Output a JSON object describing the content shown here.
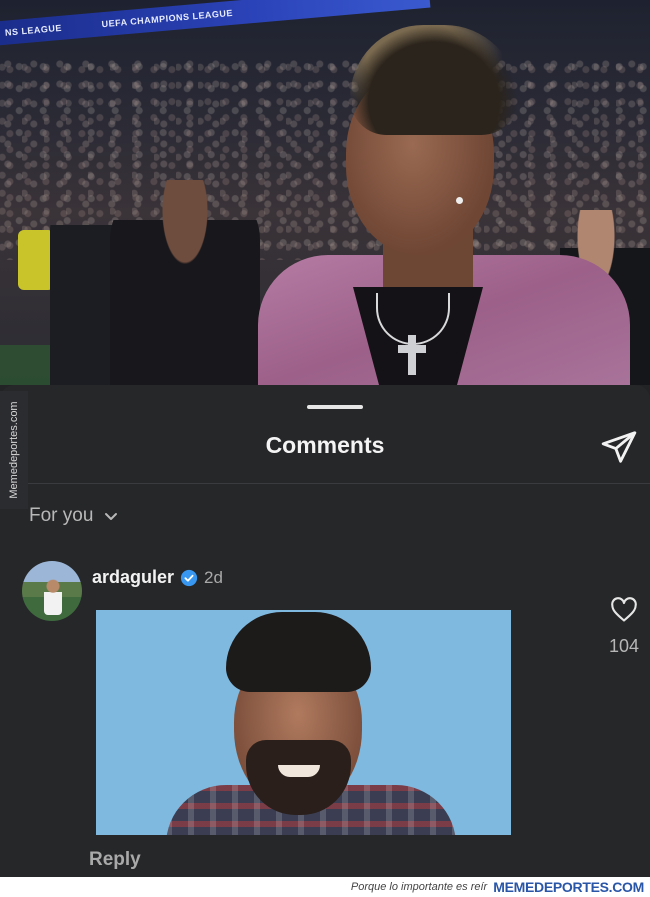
{
  "video": {
    "banner_text_1": "NS LEAGUE",
    "banner_text_2": "UEFA CHAMPIONS LEAGUE"
  },
  "sheet": {
    "title": "Comments",
    "send_icon": "send-icon",
    "filter_label": "For you",
    "filter_icon": "chevron-down-icon"
  },
  "comment": {
    "username": "ardaguler",
    "verified": true,
    "time": "2d",
    "reply_label": "Reply",
    "like_count": "104"
  },
  "watermark": {
    "side_text": "Memedeportes.com",
    "slogan": "Porque lo importante es reír",
    "brand": "MEMEDEPORTES.COM"
  },
  "colors": {
    "sheet_bg": "#262729",
    "verified_blue": "#3897f0",
    "brand_blue": "#2a56a8"
  }
}
